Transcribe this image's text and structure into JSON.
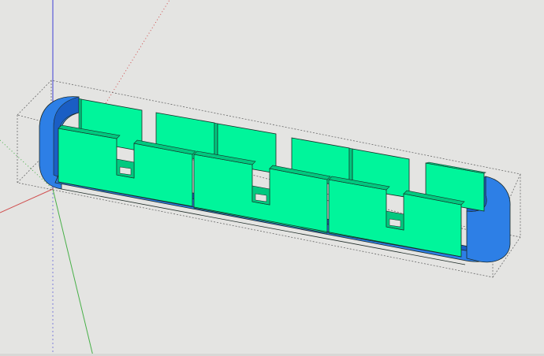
{
  "app": {
    "view": "3d-viewport",
    "background_color": "#e4e4e2"
  },
  "axes": {
    "red_axis_color": "#d05050",
    "green_axis_color": "#48b048",
    "blue_axis_color": "#3f3fd6"
  },
  "model": {
    "tray_color": "#2d7fe6",
    "tray_dark_color": "#1a5ec4",
    "divider_color": "#00f59b",
    "divider_dark_color": "#00c97f",
    "edge_color": "#1d2a26",
    "bounding_box_color": "#6a6a6a",
    "back_dividers_count": 6,
    "front_dividers_count": 6,
    "slot_count": 3
  }
}
